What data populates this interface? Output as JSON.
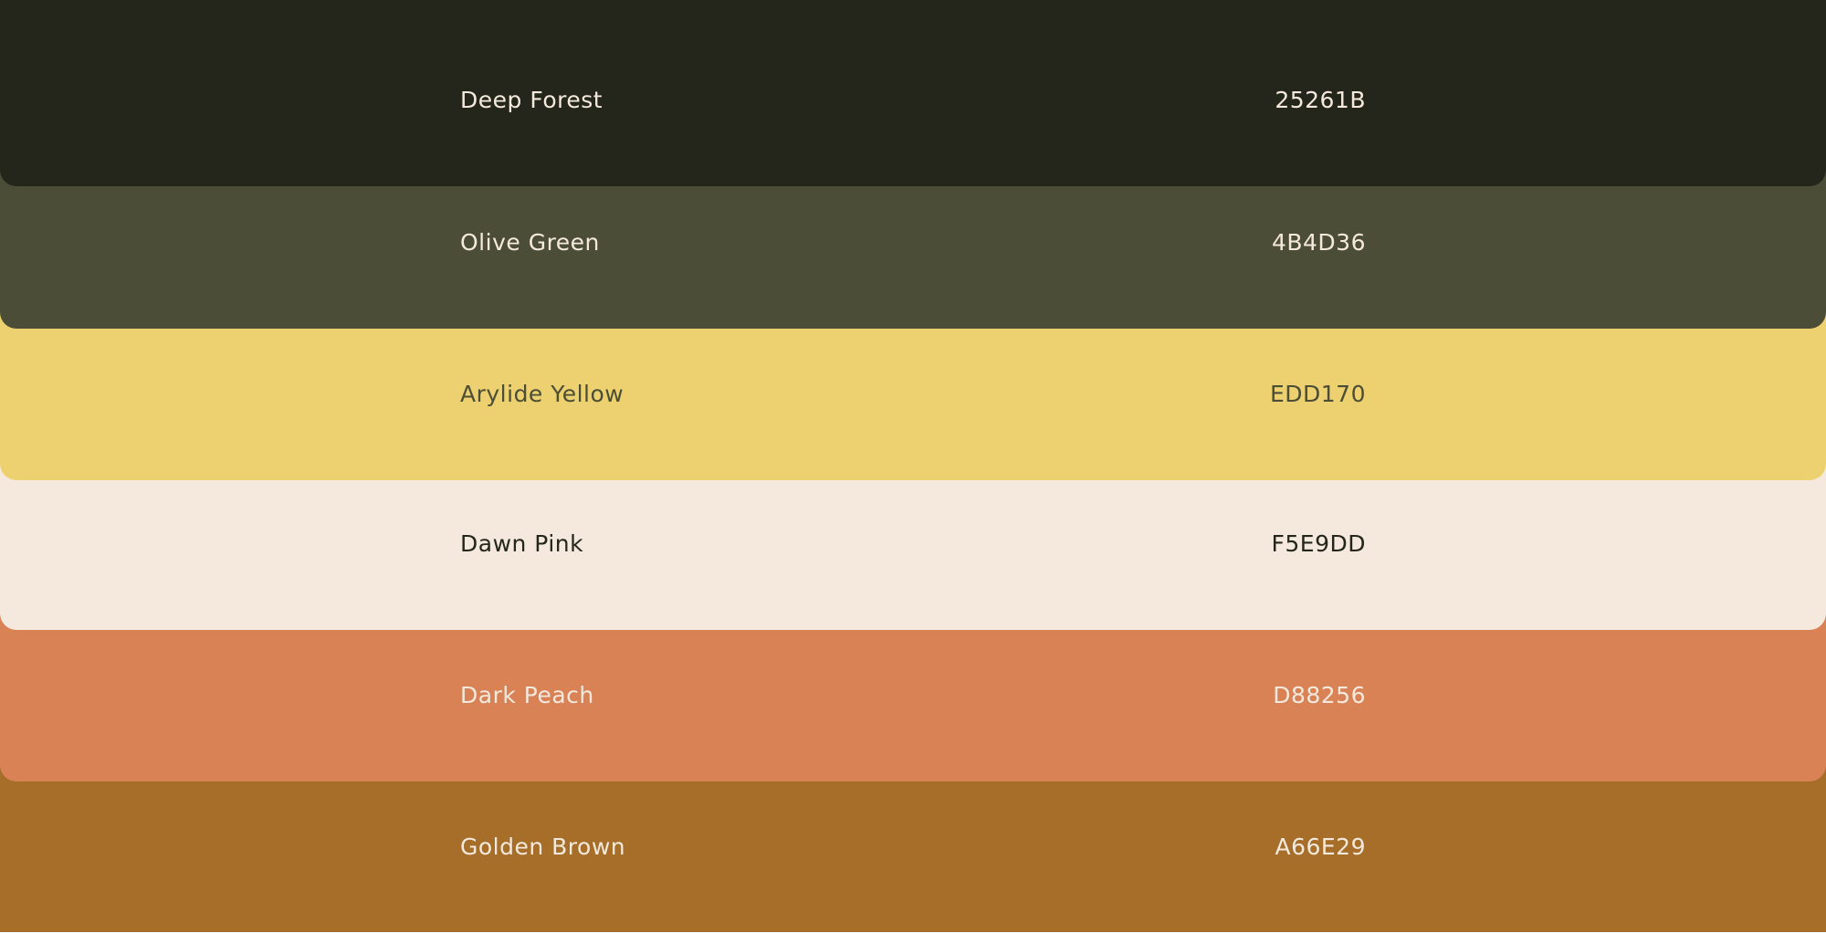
{
  "swatches": [
    {
      "name": "Deep Forest",
      "hex": "25261B",
      "color": "#25261B",
      "text_color": "#F5E9DD"
    },
    {
      "name": "Olive Green",
      "hex": "4B4D36",
      "color": "#4B4D36",
      "text_color": "#F5E9DD"
    },
    {
      "name": "Arylide Yellow",
      "hex": "EDD170",
      "color": "#EDD170",
      "text_color": "#4B4D36"
    },
    {
      "name": "Dawn Pink",
      "hex": "F5E9DD",
      "color": "#F5E9DD",
      "text_color": "#25261B"
    },
    {
      "name": "Dark Peach",
      "hex": "D88256",
      "color": "#D88256",
      "text_color": "#F5E9DD"
    },
    {
      "name": "Golden Brown",
      "hex": "A66E29",
      "color": "#A66E29",
      "text_color": "#F5E9DD"
    }
  ]
}
